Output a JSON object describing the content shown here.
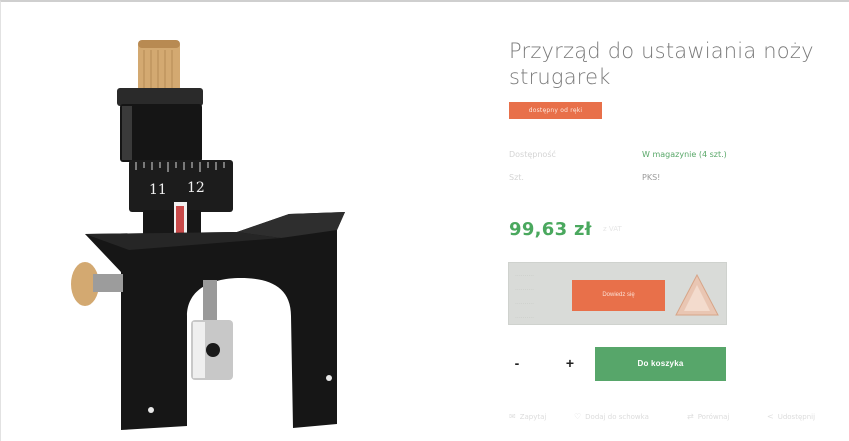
{
  "product": {
    "title": "Przyrząd do ustawiania noży strugarek",
    "badge": "dostępny od ręki",
    "availability": {
      "label": "Dostępność",
      "value": "W magazynie (4 szt.)"
    },
    "unit": {
      "label": "Szt.",
      "value": "PKS!"
    },
    "price": "99,63 zł",
    "price_note": "z VAT",
    "image_alt": "Przyrząd do ustawiania noży strugarek"
  },
  "promo": {
    "button_label": "Dowiedz się",
    "faint_lines": [
      "..........",
      "..........",
      "..........",
      ".........."
    ]
  },
  "cart": {
    "minus_label": "-",
    "plus_label": "+",
    "quantity": "",
    "add_label": "Do koszyka"
  },
  "actions": [
    {
      "label": "Zapytaj",
      "icon": "mail-icon"
    },
    {
      "label": "Dodaj do schowka",
      "icon": "heart-icon"
    },
    {
      "label": "Porównaj",
      "icon": "compare-icon"
    },
    {
      "label": "Udostępnij",
      "icon": "share-icon"
    }
  ],
  "colors": {
    "accent_orange": "#e8704a",
    "accent_green": "#57a66a",
    "price_green": "#4aa85e"
  }
}
